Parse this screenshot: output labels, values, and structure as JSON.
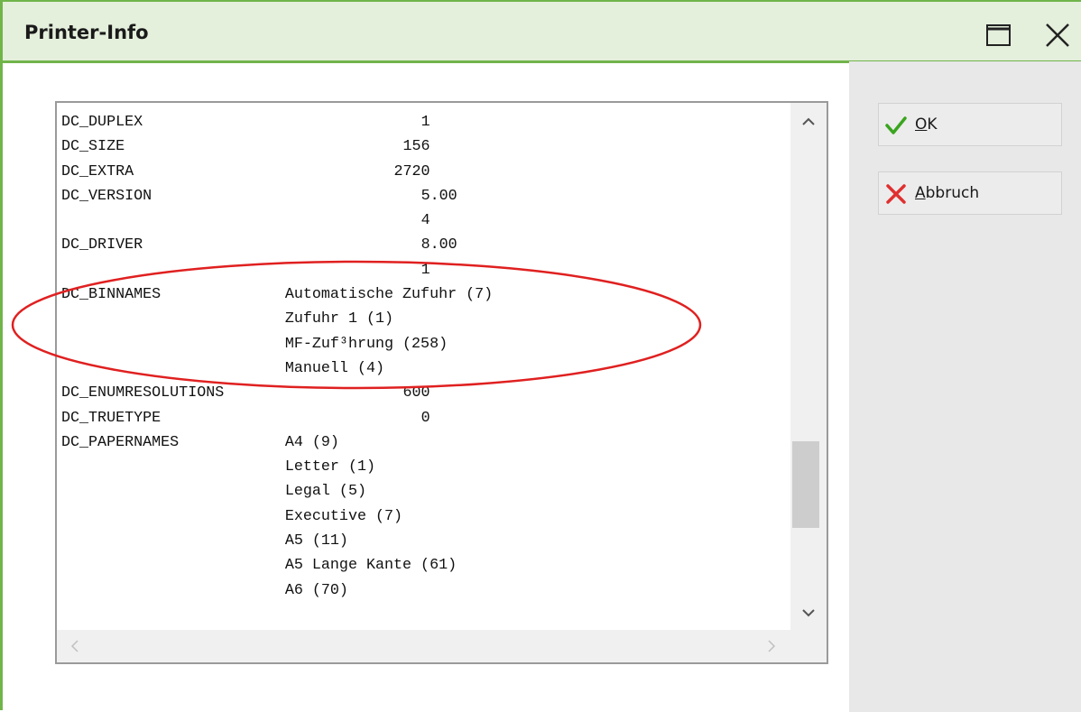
{
  "window": {
    "title": "Printer-Info",
    "border_color": "#70b44a",
    "titlebar_color": "#e4efdc"
  },
  "title_buttons": {
    "maximize_icon": "maximize-icon",
    "close_icon": "close-icon"
  },
  "buttons": {
    "ok": {
      "accelerator": "O",
      "rest": "K",
      "icon": "checkmark-icon",
      "icon_color": "#3aa51e"
    },
    "cancel": {
      "accelerator": "A",
      "rest": "bbruch",
      "icon": "x-cross-icon",
      "icon_color": "#e03030"
    }
  },
  "info_rows": [
    {
      "key": "DC_DUPLEX",
      "value": "1",
      "col": 52
    },
    {
      "key": "DC_SIZE",
      "value": "156",
      "col": 50
    },
    {
      "key": "DC_EXTRA",
      "value": "2720",
      "col": 49
    },
    {
      "key": "DC_VERSION",
      "value": "5.00",
      "col": 52
    },
    {
      "key": "",
      "value": "4",
      "col": 52
    },
    {
      "key": "DC_DRIVER",
      "value": "8.00",
      "col": 52
    },
    {
      "key": "",
      "value": "1",
      "col": 52
    },
    {
      "key": "DC_BINNAMES",
      "value": "Automatische Zufuhr (7)",
      "col": 37
    },
    {
      "key": "",
      "value": "Zufuhr 1 (1)",
      "col": 37
    },
    {
      "key": "",
      "value": "MF-Zuf³hrung (258)",
      "col": 37
    },
    {
      "key": "",
      "value": "Manuell (4)",
      "col": 37
    },
    {
      "key": "DC_ENUMRESOLUTIONS",
      "value": "600",
      "col": 50
    },
    {
      "key": "DC_TRUETYPE",
      "value": "0",
      "col": 52
    },
    {
      "key": "DC_PAPERNAMES",
      "value": "A4 (9)",
      "col": 37
    },
    {
      "key": "",
      "value": "Letter (1)",
      "col": 37
    },
    {
      "key": "",
      "value": "Legal (5)",
      "col": 37
    },
    {
      "key": "",
      "value": "Executive (7)",
      "col": 37
    },
    {
      "key": "",
      "value": "A5 (11)",
      "col": 37
    },
    {
      "key": "",
      "value": "A5 Lange Kante (61)",
      "col": 37
    },
    {
      "key": "",
      "value": "A6 (70)",
      "col": 37
    }
  ],
  "vertical_scroll": {
    "position_fraction": 0.82,
    "thumb_fraction": 0.19
  },
  "annotation": {
    "color": "#e02020",
    "target": "DC_BINNAMES"
  }
}
